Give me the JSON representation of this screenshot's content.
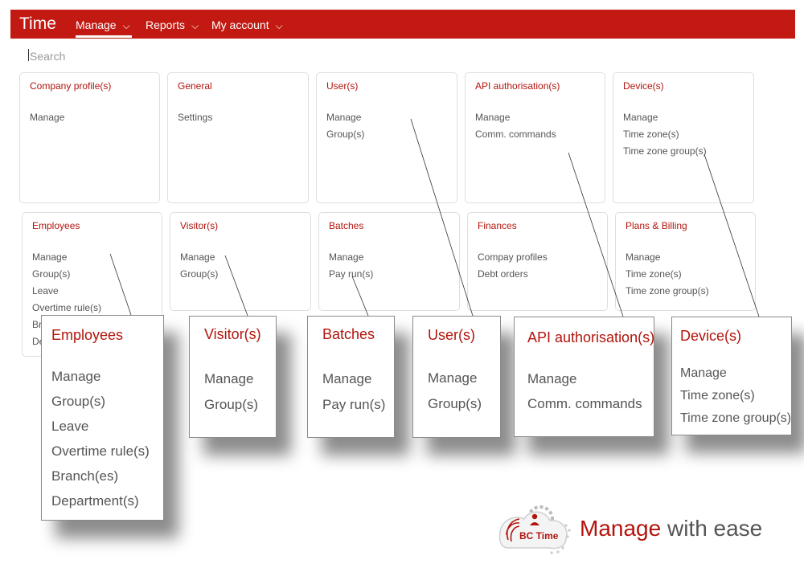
{
  "app": {
    "title": "Time"
  },
  "nav": {
    "manage": "Manage",
    "reports": "Reports",
    "my_account": "My account"
  },
  "search": {
    "placeholder": "Search"
  },
  "cards_row1": [
    {
      "title": "Company profile(s)",
      "links": [
        "Manage"
      ]
    },
    {
      "title": "General",
      "links": [
        "Settings"
      ]
    },
    {
      "title": "User(s)",
      "links": [
        "Manage",
        "Group(s)"
      ]
    },
    {
      "title": "API authorisation(s)",
      "links": [
        "Manage",
        "Comm. commands"
      ]
    },
    {
      "title": "Device(s)",
      "links": [
        "Manage",
        "Time zone(s)",
        "Time zone group(s)"
      ]
    }
  ],
  "cards_row2": [
    {
      "title": "Employees",
      "links": [
        "Manage",
        "Group(s)",
        "Leave",
        "Overtime rule(s)",
        "Br",
        "De"
      ]
    },
    {
      "title": "Visitor(s)",
      "links": [
        "Manage",
        "Group(s)"
      ]
    },
    {
      "title": "Batches",
      "links": [
        "Manage",
        "Pay run(s)"
      ]
    },
    {
      "title": "Finances",
      "links": [
        "Compay profiles",
        "Debt orders"
      ]
    },
    {
      "title": "Plans & Billing",
      "links": [
        "Manage",
        "Time zone(s)",
        "Time zone group(s)"
      ]
    }
  ],
  "zooms": [
    {
      "title": "Employees",
      "links": [
        "Manage",
        "Group(s)",
        "Leave",
        "Overtime rule(s)",
        "Branch(es)",
        "Department(s)"
      ]
    },
    {
      "title": "Visitor(s)",
      "links": [
        "Manage",
        "Group(s)"
      ]
    },
    {
      "title": "Batches",
      "links": [
        "Manage",
        "Pay run(s)"
      ]
    },
    {
      "title": "User(s)",
      "links": [
        "Manage",
        "Group(s)"
      ]
    },
    {
      "title": "API authorisation(s)",
      "links": [
        "Manage",
        "Comm. commands"
      ]
    },
    {
      "title": "Device(s)",
      "links": [
        "Manage",
        "Time zone(s)",
        "Time zone group(s)"
      ]
    }
  ],
  "logo": {
    "text": "BC Time"
  },
  "tagline": {
    "part1": "Manage",
    "part2": " with ease"
  },
  "colors": {
    "brand_red": "#c21a12",
    "title_red": "#b2140c"
  }
}
